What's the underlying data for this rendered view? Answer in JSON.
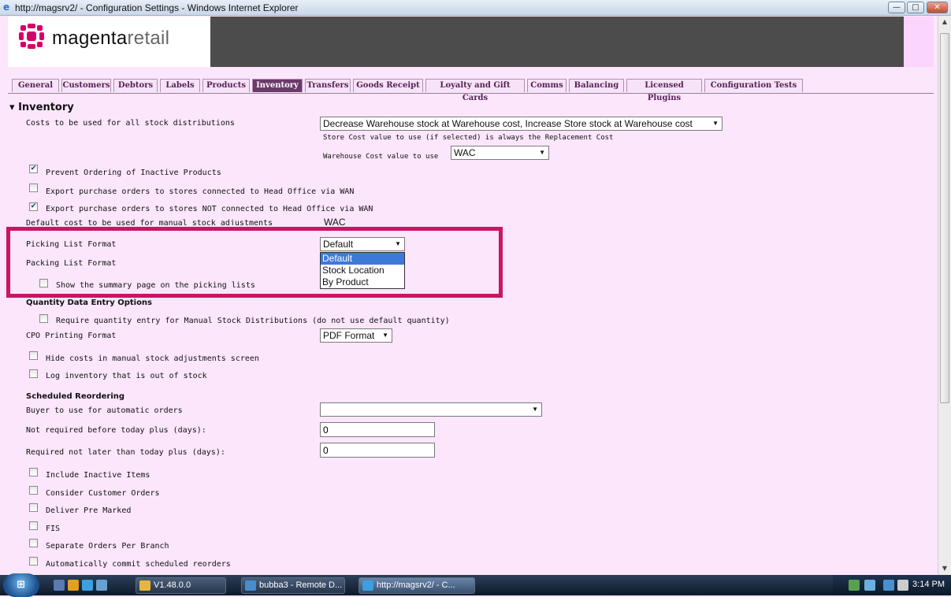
{
  "window": {
    "title": "http://magsrv2/ - Configuration Settings - Windows Internet Explorer",
    "minimize": "—",
    "maximize": "□",
    "close": "✕"
  },
  "brand": {
    "name_bold": "magenta",
    "name_light": "retail"
  },
  "tabs": [
    {
      "label": "General",
      "active": false
    },
    {
      "label": "Customers",
      "active": false
    },
    {
      "label": "Debtors",
      "active": false
    },
    {
      "label": "Labels",
      "active": false
    },
    {
      "label": "Products",
      "active": false
    },
    {
      "label": "Inventory",
      "active": true
    },
    {
      "label": "Transfers",
      "active": false
    },
    {
      "label": "Goods Receipt",
      "active": false
    },
    {
      "label": "Loyalty and Gift Cards",
      "active": false
    },
    {
      "label": "Comms",
      "active": false
    },
    {
      "label": "Balancing",
      "active": false
    },
    {
      "label": "Licensed Plugins",
      "active": false
    },
    {
      "label": "Configuration Tests",
      "active": false
    }
  ],
  "inventory": {
    "section_title": "Inventory",
    "costs_label": "Costs to be used for all stock distributions",
    "costs_value": "Decrease Warehouse stock at Warehouse cost, Increase Store stock at Warehouse cost",
    "store_cost_note": "Store Cost value to use (if selected) is always the Replacement Cost",
    "warehouse_cost_label": "Warehouse Cost value to use",
    "warehouse_cost_value": "WAC",
    "prevent_ordering": {
      "label": "Prevent Ordering of Inactive Products",
      "checked": true
    },
    "export_wan": {
      "label": "Export purchase orders to stores connected to Head Office via WAN",
      "checked": false
    },
    "export_not_wan": {
      "label": "Export purchase orders to stores NOT connected to Head Office via WAN",
      "checked": true
    },
    "default_cost_label": "Default cost to be used for manual stock adjustments",
    "default_cost_value": "WAC",
    "picking_list_label": "Picking List Format",
    "picking_list_value": "Default",
    "picking_options": [
      "Default",
      "Stock Location",
      "By Product"
    ],
    "picking_highlighted": "Default",
    "packing_list_label": "Packing List Format",
    "summary_page": {
      "label": "Show the summary page on the picking lists",
      "checked": false
    }
  },
  "quantity": {
    "heading": "Quantity Data Entry Options",
    "require_qty": {
      "label": "Require quantity entry for Manual Stock Distributions (do not use default quantity)",
      "checked": false
    },
    "cpo_label": "CPO Printing Format",
    "cpo_value": "PDF Format",
    "hide_costs": {
      "label": "Hide costs in manual stock adjustments screen",
      "checked": false
    },
    "log_inventory": {
      "label": "Log inventory that is out of stock",
      "checked": false
    }
  },
  "reorder": {
    "heading": "Scheduled Reordering",
    "buyer_label": "Buyer to use for automatic orders",
    "buyer_value": "",
    "not_before_label": "Not required before today plus (days):",
    "not_before_value": "0",
    "not_later_label": "Required not later than today plus (days):",
    "not_later_value": "0",
    "options": [
      {
        "label": "Include Inactive Items",
        "checked": false
      },
      {
        "label": "Consider Customer Orders",
        "checked": false
      },
      {
        "label": "Deliver Pre Marked",
        "checked": false
      },
      {
        "label": "FIS",
        "checked": false
      },
      {
        "label": "Separate Orders Per Branch",
        "checked": false
      },
      {
        "label": "Automatically commit scheduled reorders",
        "checked": false
      }
    ]
  },
  "taskbar": {
    "buttons": [
      {
        "label": "V1.48.0.0",
        "icon_color": "#e8b640"
      },
      {
        "label": "bubba3 - Remote D...",
        "icon_color": "#4a8ad0"
      },
      {
        "label": "http://magsrv2/ - C...",
        "icon_color": "#3aa0e0",
        "active": true
      }
    ],
    "clock": "3:14 PM"
  }
}
